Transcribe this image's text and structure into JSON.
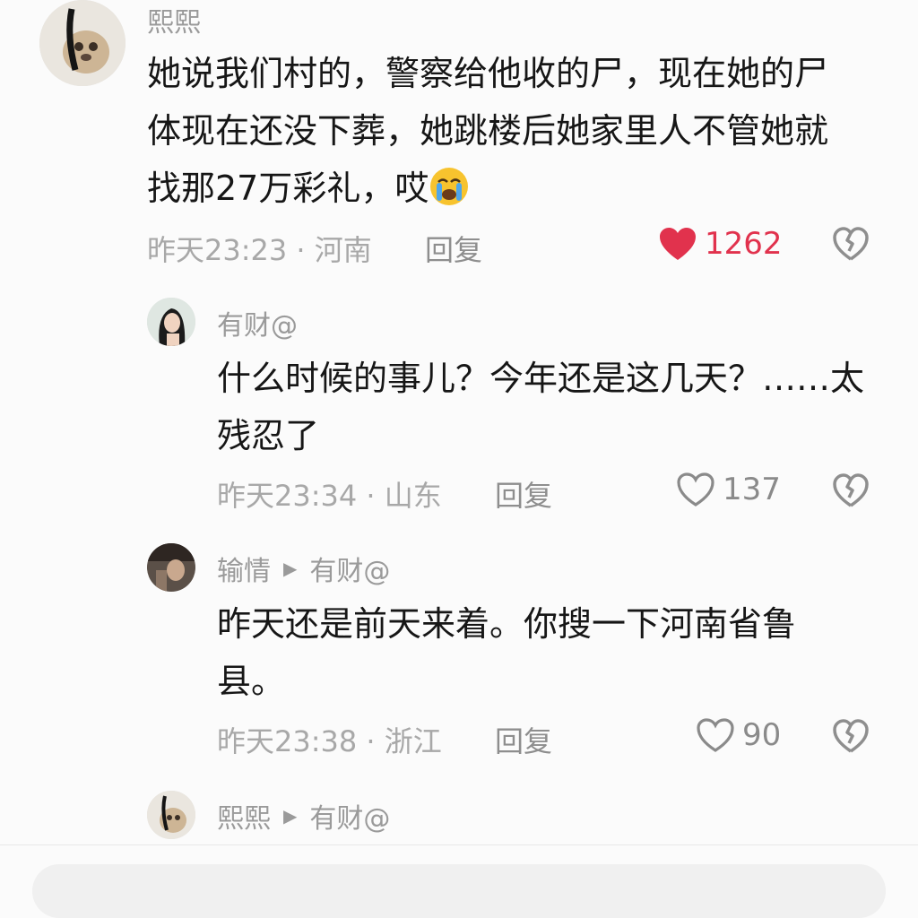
{
  "comments": [
    {
      "username": "熙熙",
      "reply_to": "",
      "content_lines": [
        "她说我们村的，警察给他收的尸，现在她的尸",
        "体现在还没下葬，她跳楼后她家里人不管她就",
        "找那27万彩礼，哎"
      ],
      "emoji": "loudly-crying-face-emoji",
      "meta": "昨天23:23 · 河南",
      "reply_label": "回复",
      "like_count": "1262",
      "liked": true
    },
    {
      "username": "有财@",
      "reply_to": "",
      "content_lines": [
        "什么时候的事儿？今年还是这几天？……太",
        "残忍了"
      ],
      "meta": "昨天23:34 · 山东",
      "reply_label": "回复",
      "like_count": "137",
      "liked": false
    },
    {
      "username": "输情",
      "reply_to": "有财@",
      "content_lines": [
        "昨天还是前天来着。你搜一下河南省鲁",
        "县。"
      ],
      "meta": "昨天23:38 · 浙江",
      "reply_label": "回复",
      "like_count": "90",
      "liked": false
    },
    {
      "username": "熙熙",
      "reply_to": "有财@"
    }
  ],
  "colors": {
    "liked_heart": "#e1324d",
    "muted_text": "#a8a8a8",
    "background": "#fbfbfb"
  },
  "icons": {
    "like": "heart-icon",
    "dislike": "broken-heart-icon",
    "reply_arrow": "triangle-right-icon"
  }
}
